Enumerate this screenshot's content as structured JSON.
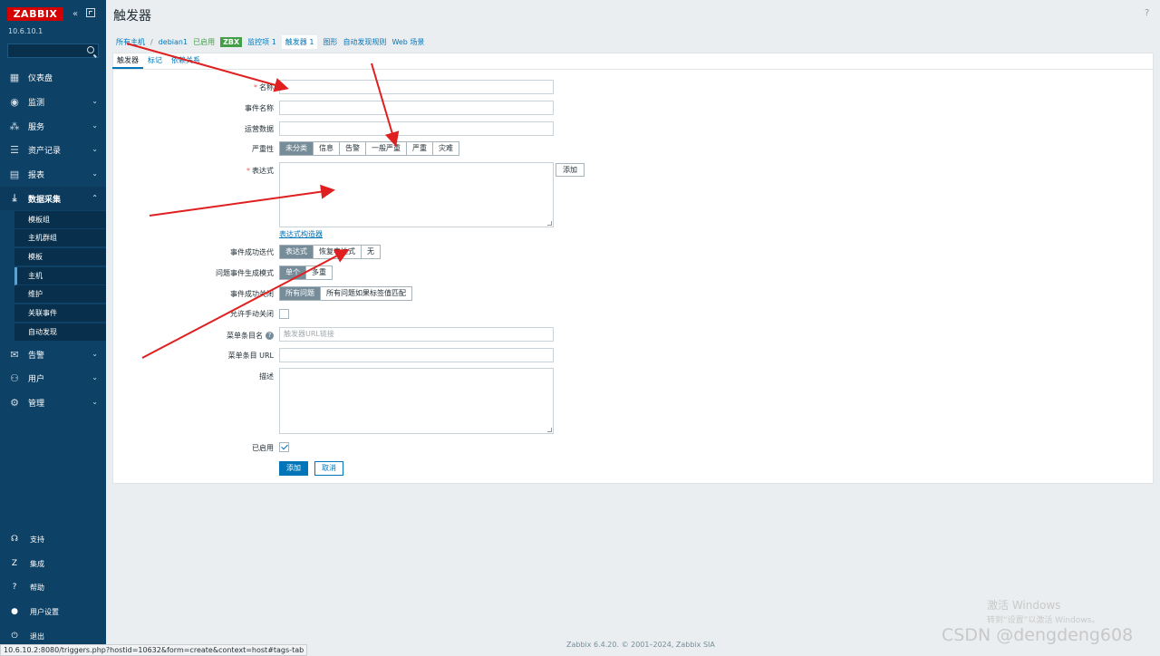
{
  "sidebar": {
    "logo": "ZABBIX",
    "version": "10.6.10.1",
    "collapse_glyph": "«",
    "nav": [
      {
        "label": "仪表盘",
        "icon": "dashboard-icon"
      },
      {
        "label": "监测",
        "icon": "eye-icon"
      },
      {
        "label": "服务",
        "icon": "services-icon"
      },
      {
        "label": "资产记录",
        "icon": "list-icon"
      },
      {
        "label": "报表",
        "icon": "report-icon"
      },
      {
        "label": "数据采集",
        "icon": "download-icon"
      }
    ],
    "sub": [
      "模板组",
      "主机群组",
      "模板",
      "主机",
      "维护",
      "关联事件",
      "自动发现"
    ],
    "nav2": [
      {
        "label": "告警",
        "icon": "mail-icon"
      },
      {
        "label": "用户",
        "icon": "users-icon"
      },
      {
        "label": "管理",
        "icon": "gear-icon"
      }
    ],
    "bottom": [
      {
        "label": "支持",
        "glyph": "☊"
      },
      {
        "label": "集成",
        "glyph": "Z"
      },
      {
        "label": "帮助",
        "glyph": "?"
      },
      {
        "label": "用户设置",
        "glyph": "●"
      },
      {
        "label": "退出",
        "glyph": "⏻"
      }
    ]
  },
  "header": {
    "title": "触发器",
    "help": "?"
  },
  "breadcrumb": {
    "all_hosts": "所有主机",
    "separator": "/",
    "host": "debian1",
    "enabled": "已启用",
    "zbx": "ZBX",
    "items": "监控项 1",
    "triggers": "触发器 1",
    "graphs": "图形",
    "discovery": "自动发现规则",
    "web": "Web 场景"
  },
  "tabs": [
    "触发器",
    "标记",
    "依赖关系"
  ],
  "form": {
    "name_label": "名称",
    "event_name_label": "事件名称",
    "opdata_label": "运营数据",
    "severity_label": "严重性",
    "severity_options": [
      "未分类",
      "信息",
      "告警",
      "一般严重",
      "严重",
      "灾难"
    ],
    "expression_label": "表达式",
    "add_label": "添加",
    "expression_builder": "表达式构造器",
    "recovery_label": "事件成功迭代",
    "recovery_options": [
      "表达式",
      "恢复表达式",
      "无"
    ],
    "problem_mode_label": "问题事件生成模式",
    "problem_mode_options": [
      "单个",
      "多重"
    ],
    "ok_close_label": "事件成功关闭",
    "ok_close_options": [
      "所有问题",
      "所有问题如果标签值匹配"
    ],
    "manual_close_label": "允许手动关闭",
    "menu_name_label": "菜单条目名",
    "menu_name_placeholder": "触发器URL链接",
    "menu_url_label": "菜单条目 URL",
    "description_label": "描述",
    "enabled_label": "已启用",
    "submit": "添加",
    "cancel": "取消"
  },
  "footer": {
    "copyright": "Zabbix 6.4.20. © 2001–2024, Zabbix SIA"
  },
  "statusbar": {
    "url": "10.6.10.2:8080/triggers.php?hostid=10632&form=create&context=host#tags-tab"
  },
  "overlay": {
    "activate_title": "激活 Windows",
    "activate_sub": "转到“设置”以激活 Windows。",
    "watermark": "CSDN @dengdeng608"
  },
  "colors": {
    "sidebar": "#0e4166",
    "logo": "#d40000",
    "accent": "#0275b8",
    "green": "#429e47",
    "annotation_arrows": "#e02020"
  }
}
